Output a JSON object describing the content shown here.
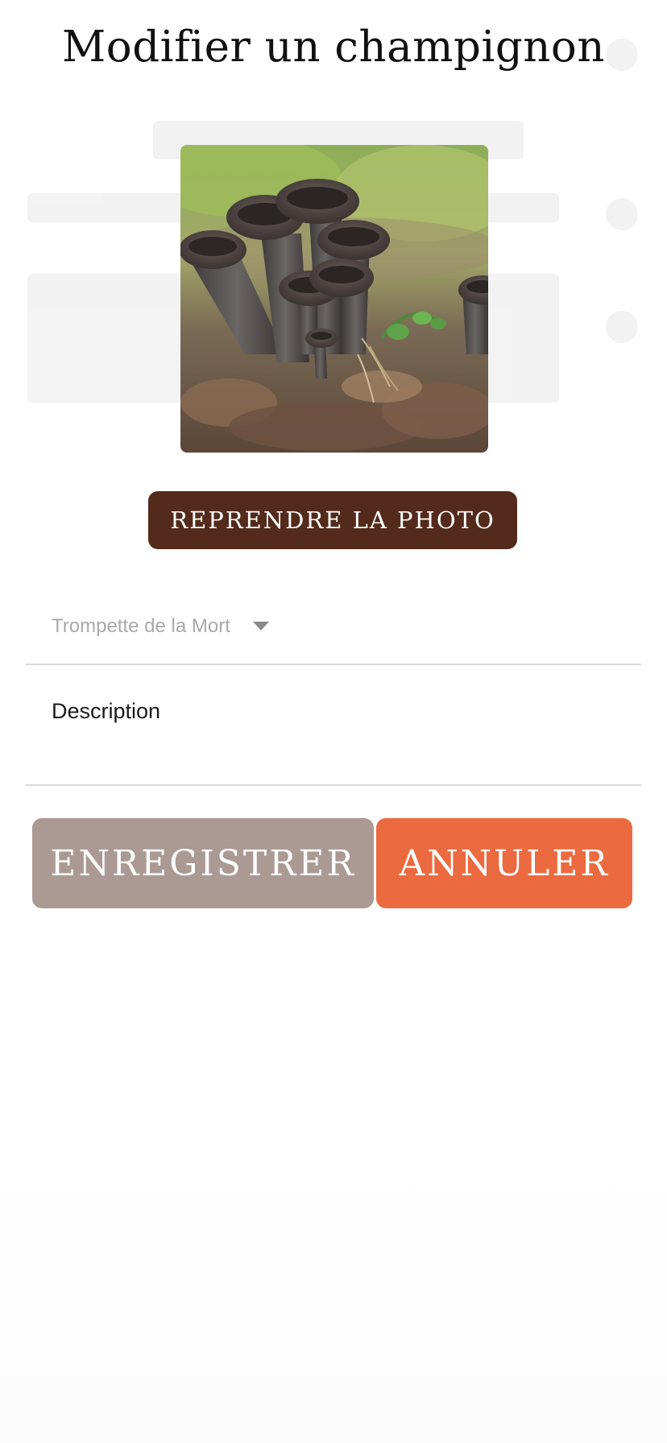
{
  "dialog": {
    "title": "Modifier un champignon"
  },
  "photo": {
    "icon": "mushroom-photo",
    "alt_subject": "Trompette de la Mort"
  },
  "buttons": {
    "retake_label": "REPRENDRE LA PHOTO",
    "save_label": "ENREGISTRER",
    "cancel_label": "ANNULER"
  },
  "form": {
    "species_selected": "Trompette de la Mort",
    "description_placeholder": "Description"
  },
  "colors": {
    "retake_button": "#532a1b",
    "save_button": "#ab9a93",
    "cancel_button": "#ec6a3f"
  }
}
